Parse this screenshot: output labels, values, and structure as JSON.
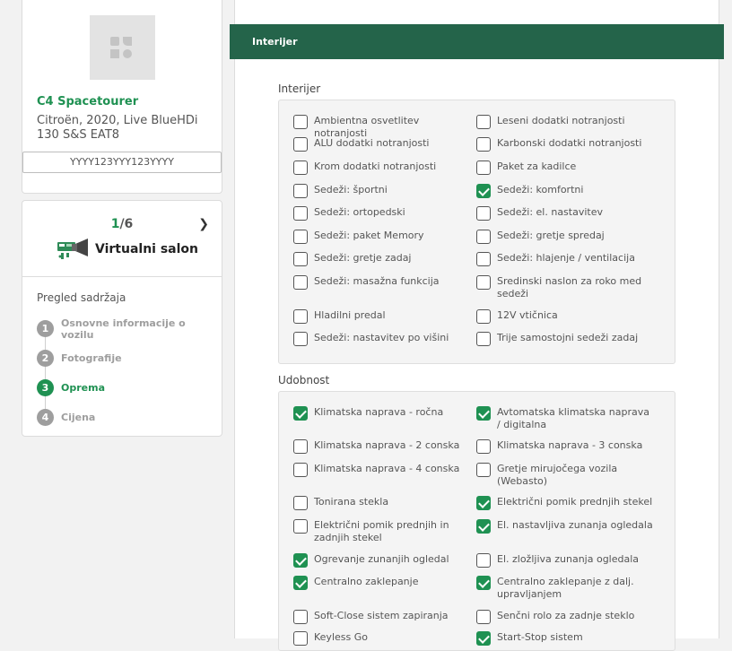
{
  "car": {
    "title": "C4 Spacetourer",
    "subtitle": "Citroën, 2020, Live BlueHDi 130 S&S EAT8",
    "vin": "YYYY123YYY123YYYY"
  },
  "salon": {
    "counter_current": "1",
    "counter_total": "/6",
    "label": "Virtualni salon"
  },
  "overview": {
    "title": "Pregled sadržaja",
    "steps": [
      {
        "num": "1",
        "label": "Osnovne informacije o vozilu",
        "active": false
      },
      {
        "num": "2",
        "label": "Fotografije",
        "active": false
      },
      {
        "num": "3",
        "label": "Oprema",
        "active": true
      },
      {
        "num": "4",
        "label": "Cijena",
        "active": false
      }
    ]
  },
  "section": {
    "header": "Interijer"
  },
  "groups": [
    {
      "title": "Interijer",
      "options": [
        {
          "label": "Ambientna osvetlitev notranjosti",
          "checked": false
        },
        {
          "label": "Leseni dodatki notranjosti",
          "checked": false
        },
        {
          "label": "ALU dodatki notranjosti",
          "checked": false
        },
        {
          "label": "Karbonski dodatki notranjosti",
          "checked": false
        },
        {
          "label": "Krom dodatki notranjosti",
          "checked": false
        },
        {
          "label": "Paket za kadilce",
          "checked": false
        },
        {
          "label": "Sedeži: športni",
          "checked": false
        },
        {
          "label": "Sedeži: komfortni",
          "checked": true
        },
        {
          "label": "Sedeži: ortopedski",
          "checked": false
        },
        {
          "label": "Sedeži: el. nastavitev",
          "checked": false
        },
        {
          "label": "Sedeži: paket Memory",
          "checked": false
        },
        {
          "label": "Sedeži: gretje spredaj",
          "checked": false
        },
        {
          "label": "Sedeži: gretje zadaj",
          "checked": false
        },
        {
          "label": "Sedeži: hlajenje / ventilacija",
          "checked": false
        },
        {
          "label": "Sedeži: masažna funkcija",
          "checked": false
        },
        {
          "label": "Sredinski naslon za roko med sedeži",
          "checked": false
        },
        {
          "label": "Hladilni predal",
          "checked": false
        },
        {
          "label": "12V vtičnica",
          "checked": false
        },
        {
          "label": "Sedeži: nastavitev po višini",
          "checked": false
        },
        {
          "label": "Trije samostojni sedeži zadaj",
          "checked": false
        }
      ]
    },
    {
      "title": "Udobnost",
      "options": [
        {
          "label": "Klimatska naprava - ročna",
          "checked": true
        },
        {
          "label": "Avtomatska klimatska naprava / digitalna",
          "checked": true
        },
        {
          "label": "Klimatska naprava - 2 conska",
          "checked": false
        },
        {
          "label": "Klimatska naprava - 3 conska",
          "checked": false
        },
        {
          "label": "Klimatska naprava - 4 conska",
          "checked": false
        },
        {
          "label": "Gretje mirujočega vozila (Webasto)",
          "checked": false
        },
        {
          "label": "Tonirana stekla",
          "checked": false
        },
        {
          "label": "Električni pomik prednjih stekel",
          "checked": true
        },
        {
          "label": "Električni pomik prednjih in zadnjih stekel",
          "checked": false
        },
        {
          "label": "El. nastavljiva zunanja ogledala",
          "checked": true
        },
        {
          "label": "Ogrevanje zunanjih ogledal",
          "checked": true
        },
        {
          "label": "El. zložljiva zunanja ogledala",
          "checked": false
        },
        {
          "label": "Centralno zaklepanje",
          "checked": true
        },
        {
          "label": "Centralno zaklepanje z dalj. upravljanjem",
          "checked": true
        },
        {
          "label": "Soft-Close sistem zapiranja",
          "checked": false
        },
        {
          "label": "Senčni rolo za zadnje steklo",
          "checked": false
        },
        {
          "label": "Keyless Go",
          "checked": false
        },
        {
          "label": "Start-Stop sistem",
          "checked": true
        }
      ]
    }
  ]
}
